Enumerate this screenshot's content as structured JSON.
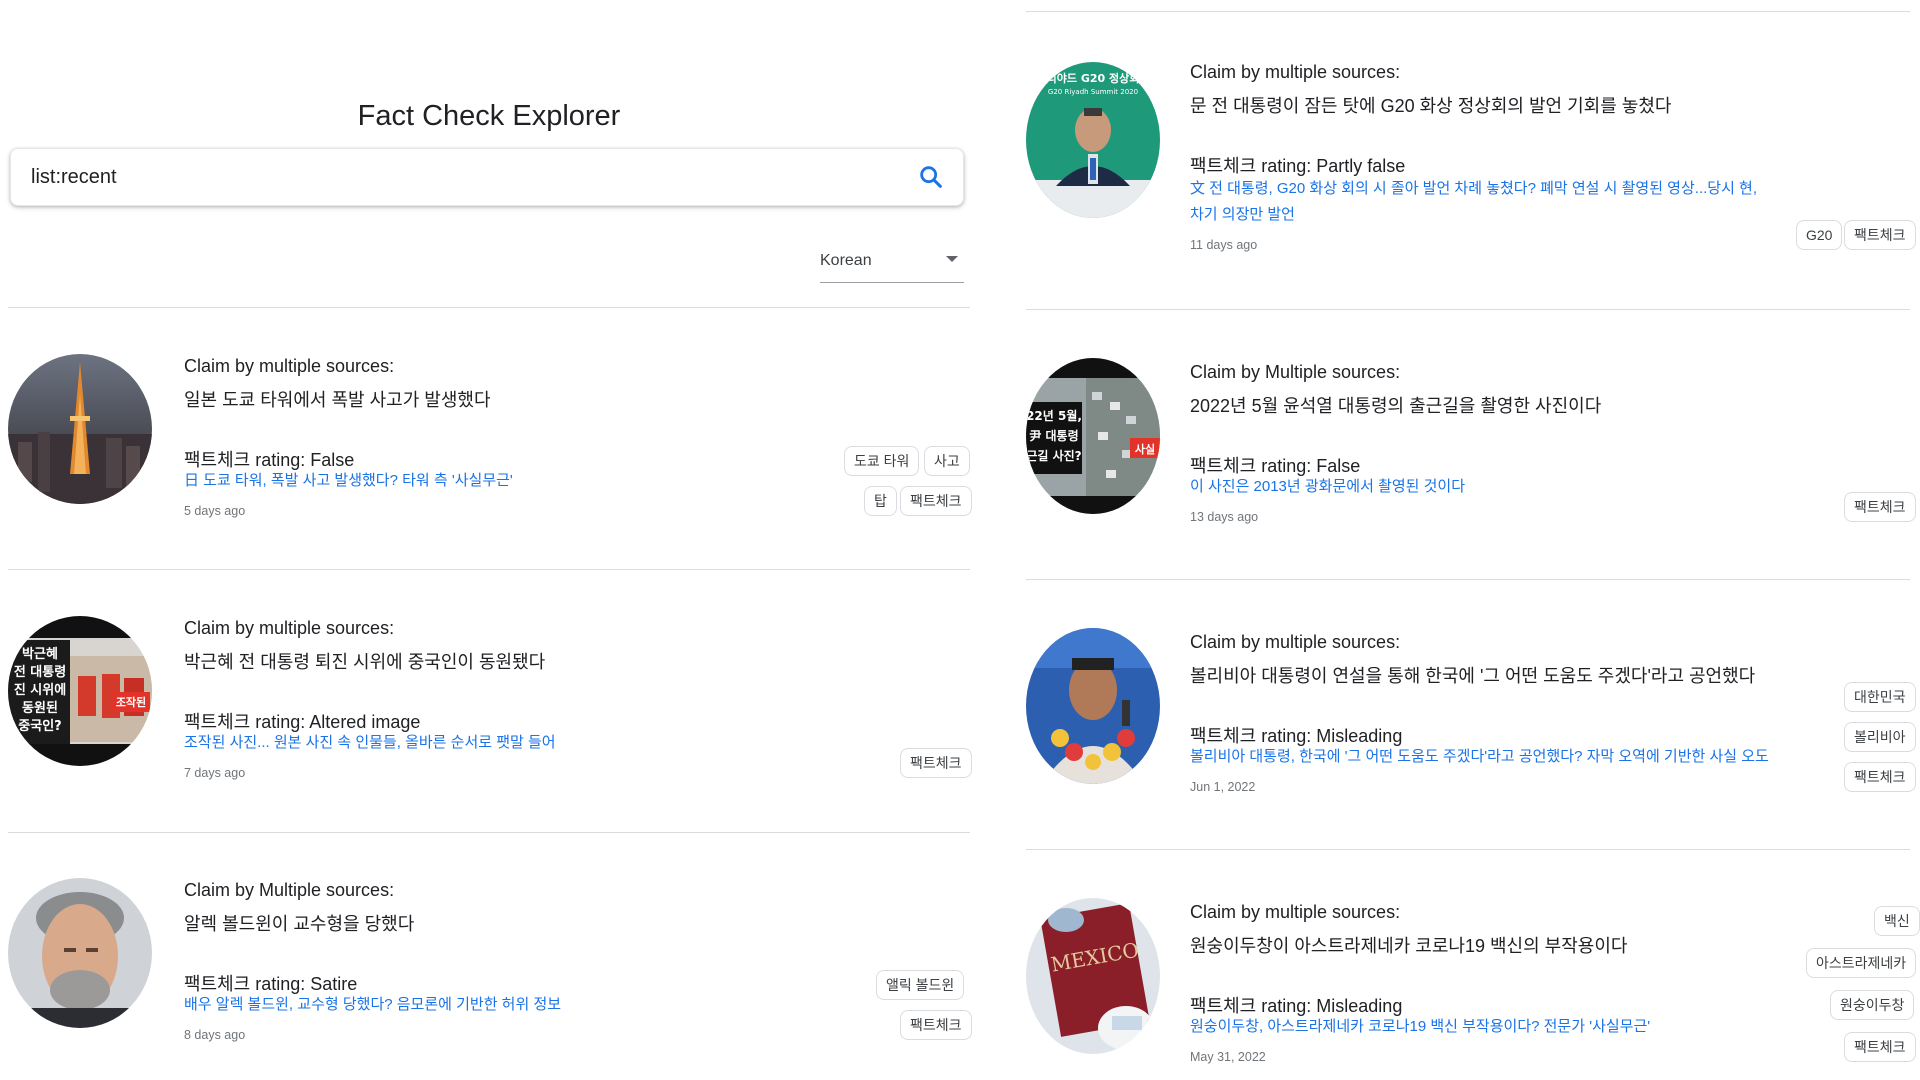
{
  "app": {
    "title": "Fact Check Explorer"
  },
  "search": {
    "value": "list:recent"
  },
  "language": {
    "selected": "Korean"
  },
  "colors": {
    "link": "#1a73e8",
    "divider": "#dadce0",
    "secondary_text": "#70757a"
  },
  "left_results": [
    {
      "claim_label": "Claim by multiple sources:",
      "claim": "일본 도쿄 타워에서 폭발 사고가 발생했다",
      "publisher": "팩트체크",
      "rating_label": " rating: ",
      "rating": "False",
      "article": "日 도쿄 타워, 폭발 사고 발생했다? 타워 측 '사실무근'",
      "date": "5 days ago",
      "tags": [
        "도쿄 타워",
        "사고",
        "탑",
        "팩트체크"
      ],
      "thumbnail_icon": "tokyo-tower-image"
    },
    {
      "claim_label": "Claim by multiple sources:",
      "claim": "박근혜 전 대통령 퇴진 시위에 중국인이 동원됐다",
      "publisher": "팩트체크",
      "rating_label": " rating: ",
      "rating": "Altered image",
      "article": "조작된 사진... 원본 사진 속 인물들, 올바른 순서로 팻말 들어",
      "date": "7 days ago",
      "tags": [
        "팩트체크"
      ],
      "thumbnail_icon": "protest-image",
      "thumb_text": [
        "박근혜",
        "전 대통령",
        "진 시위에",
        "동원된",
        "중국인?"
      ],
      "thumb_badge": "조작된"
    },
    {
      "claim_label": "Claim by Multiple sources:",
      "claim": "알렉 볼드윈이 교수형을 당했다",
      "publisher": "팩트체크",
      "rating_label": " rating: ",
      "rating": "Satire",
      "article": "배우 알렉 볼드윈, 교수형 당했다? 음모론에 기반한 허위 정보",
      "date": "8 days ago",
      "tags": [
        "앨릭 볼드윈",
        "팩트체크"
      ],
      "thumbnail_icon": "portrait-image"
    }
  ],
  "right_results": [
    {
      "claim_label": "Claim by multiple sources:",
      "claim": "문 전 대통령이 잠든 탓에 G20 화상 정상회의 발언 기회를 놓쳤다",
      "publisher": "팩트체크",
      "rating_label": " rating: ",
      "rating": "Partly false",
      "article": "文 전 대통령, G20 화상 회의 시 졸아 발언 차례 놓쳤다? 폐막 연설 시 촬영된 영상...당시 현, 차기 의장만 발언",
      "date": "11 days ago",
      "tags": [
        "G20",
        "팩트체크"
      ],
      "thumbnail_icon": "g20-summit-image",
      "thumb_text": [
        "리야드 G20 정상회",
        "G20 Riyadh Summit 2020"
      ]
    },
    {
      "claim_label": "Claim by Multiple sources:",
      "claim": "2022년 5월 윤석열 대통령의 출근길을 촬영한 사진이다",
      "publisher": "팩트체크",
      "rating_label": " rating: ",
      "rating": "False",
      "article": "이 사진은 2013년 광화문에서 촬영된 것이다",
      "date": "13 days ago",
      "tags": [
        "팩트체크"
      ],
      "thumbnail_icon": "traffic-image",
      "thumb_text": [
        "22년 5월,",
        "尹 대통령",
        "근길 사진?"
      ],
      "thumb_badge": "사실"
    },
    {
      "claim_label": "Claim by multiple sources:",
      "claim": "볼리비아 대통령이 연설을 통해 한국에 '그 어떤 도움도 주겠다'라고 공언했다",
      "publisher": "팩트체크",
      "rating_label": " rating: ",
      "rating": "Misleading",
      "article": "볼리비아 대통령, 한국에 '그 어떤 도움도 주겠다'라고 공언했다? 자막 오역에 기반한 사실 오도",
      "date": "Jun 1, 2022",
      "tags": [
        "대한민국",
        "볼리비아",
        "팩트체크"
      ],
      "thumbnail_icon": "speaker-image"
    },
    {
      "claim_label": "Claim by multiple sources:",
      "claim": "원숭이두창이 아스트라제네카 코로나19 백신의 부작용이다",
      "publisher": "팩트체크",
      "rating_label": " rating: ",
      "rating": "Misleading",
      "article": "원숭이두창, 아스트라제네카 코로나19 백신 부작용이다? 전문가 '사실무근'",
      "date": "May 31, 2022",
      "tags": [
        "백신",
        "아스트라제네카",
        "원숭이두창",
        "팩트체크"
      ],
      "thumbnail_icon": "passport-image",
      "thumb_text": [
        "MEXICO"
      ]
    }
  ]
}
